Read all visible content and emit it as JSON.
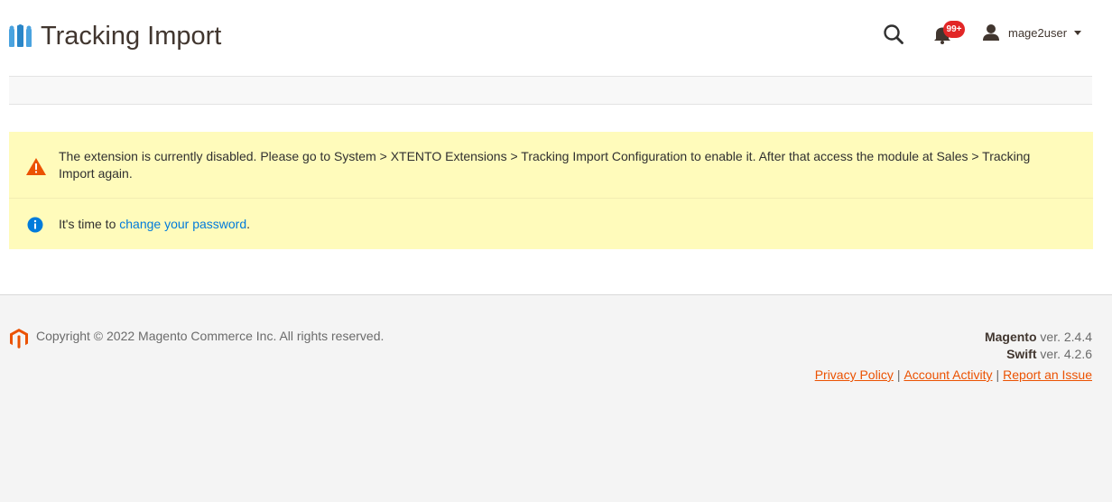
{
  "header": {
    "title": "Tracking Import",
    "notifications_count": "99+",
    "username": "mage2user",
    "icons": {
      "logo": "module-logo-icon",
      "search": "search-icon",
      "notifications": "bell-icon",
      "user": "user-icon"
    }
  },
  "messages": {
    "warning_text": "The extension is currently disabled. Please go to System > XTENTO Extensions > Tracking Import Configuration to enable it. After that access the module at Sales > Tracking Import again.",
    "notice_prefix": "It's time to ",
    "notice_link": "change your password",
    "notice_suffix": "."
  },
  "footer": {
    "copyright": "Copyright © 2022 Magento Commerce Inc. All rights reserved.",
    "magento_label": "Magento",
    "magento_version": " ver. 2.4.4",
    "swift_label": "Swift",
    "swift_version": " ver. 4.2.6",
    "links": [
      "Privacy Policy",
      "Account Activity",
      "Report an Issue"
    ],
    "separator": "|"
  },
  "colors": {
    "accent": "#eb5202",
    "link": "#007bdb",
    "message_bg": "#fffbbb",
    "badge": "#e22626"
  }
}
